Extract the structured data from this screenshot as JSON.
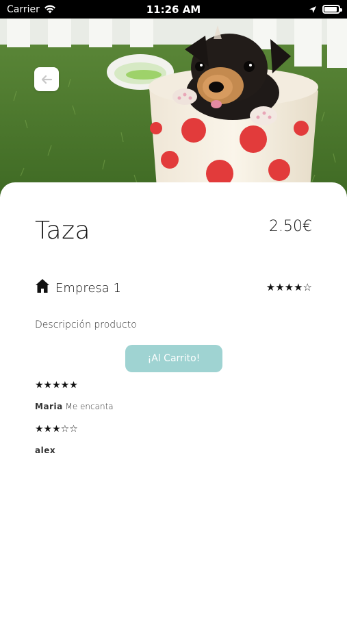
{
  "status_bar": {
    "carrier": "Carrier",
    "time": "11:26 AM"
  },
  "product": {
    "name": "Taza",
    "price": "2.50€",
    "company": "Empresa 1",
    "company_rating": "★★★★☆",
    "description": "Descripción producto",
    "cart_button_label": "¡Al Carrito!"
  },
  "reviews": [
    {
      "stars": "★★★★★",
      "author": "Maria",
      "comment": "Me encanta"
    },
    {
      "stars": "★★★☆☆",
      "author": "alex",
      "comment": ""
    }
  ],
  "colors": {
    "cart_button": "#9fd3d2",
    "status_bar": "#000000"
  }
}
